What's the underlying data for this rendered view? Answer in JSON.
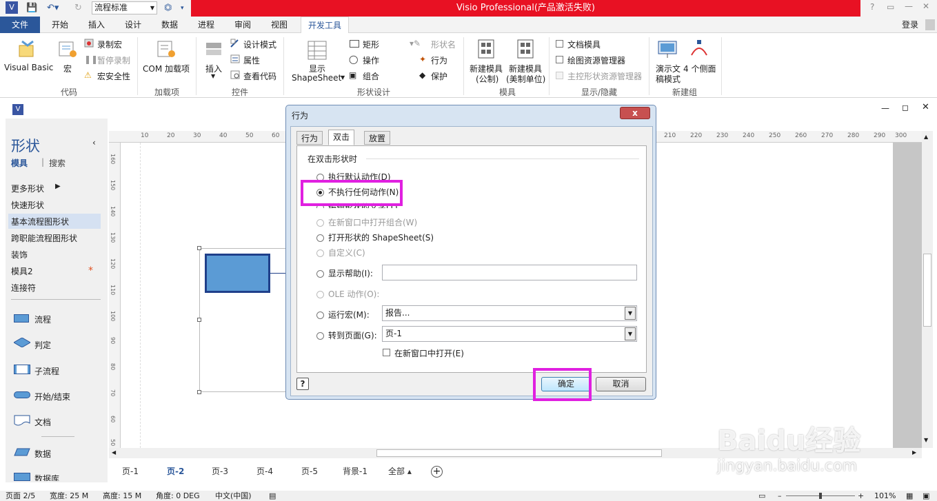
{
  "window": {
    "title": "Visio Professional(产品激活失败)",
    "style_combo": "流程标准",
    "login": "登录"
  },
  "menu": [
    "文件",
    "开始",
    "插入",
    "设计",
    "数据",
    "进程",
    "审阅",
    "视图",
    "开发工具"
  ],
  "ribbon": {
    "code": {
      "label": "代码",
      "visual_basic": "Visual Basic",
      "macros": "宏",
      "record_macro": "录制宏",
      "pause_record": "暂停录制",
      "macro_security": "宏安全性"
    },
    "addins": {
      "label": "加载项",
      "com": "COM 加载项"
    },
    "controls": {
      "label": "控件",
      "insert": "插入",
      "design_mode": "设计模式",
      "properties": "属性",
      "view_code": "查看代码"
    },
    "shape_design": {
      "label": "形状设计",
      "show_shapesheet_1": "显示",
      "show_shapesheet_2": "ShapeSheet",
      "rectangle": "矩形",
      "operations": "操作",
      "group": "组合",
      "shape_name": "形状名",
      "behavior": "行为",
      "protect": "保护"
    },
    "stencil": {
      "label": "模具",
      "new_metric_1": "新建模具",
      "new_metric_2": "(公制)",
      "new_us_1": "新建模具",
      "new_us_2": "(美制单位)"
    },
    "show_hide": {
      "label": "显示/隐藏",
      "doc_stencil": "文档模具",
      "drawing_explorer": "绘图资源管理器",
      "master_explorer": "主控形状资源管理器"
    },
    "new_group": {
      "label": "新建组",
      "demo_1": "演示文",
      "demo_2": "稿模式",
      "four_sides": "4 个侧面"
    }
  },
  "shapes_pane": {
    "title": "形状",
    "tab_stencils": "模具",
    "tab_search": "搜索",
    "nav": [
      "更多形状",
      "快速形状",
      "基本流程图形状",
      "跨职能流程图形状",
      "装饰",
      "模具2",
      "连接符"
    ],
    "shapes": [
      "流程",
      "判定",
      "子流程",
      "开始/结束",
      "文档",
      "数据",
      "数据库"
    ]
  },
  "rulers": {
    "top": [
      "10",
      "20",
      "30",
      "40",
      "50",
      "60",
      "210",
      "220",
      "230",
      "240",
      "250",
      "260",
      "270",
      "280",
      "290",
      "300"
    ],
    "left": [
      "160",
      "150",
      "140",
      "130",
      "120",
      "110",
      "100",
      "90",
      "80",
      "70",
      "60",
      "50"
    ]
  },
  "page_tabs": [
    "页-1",
    "页-2",
    "页-3",
    "页-4",
    "页-5",
    "背景-1",
    "全部 ▴"
  ],
  "status": {
    "page": "页面 2/5",
    "width": "宽度: 25 M",
    "height": "高度: 15 M",
    "angle": "角度: 0 DEG",
    "language": "中文(中国)",
    "zoom": "101%"
  },
  "dialog": {
    "title": "行为",
    "close": "x",
    "tabs": [
      "行为",
      "双击",
      "放置"
    ],
    "section": "在双击形状时",
    "opt_default": "执行默认动作(D)",
    "opt_none": "不执行任何动作(N)",
    "opt_edit_text": "编辑形状的文字(T)",
    "opt_open_group": "在新窗口中打开组合(W)",
    "opt_shapesheet": "打开形状的 ShapeSheet(S)",
    "opt_custom": "自定义(C)",
    "opt_help": "显示帮助(I):",
    "opt_ole": "OLE 动作(O):",
    "opt_macro": "运行宏(M):",
    "macro_value": "报告...",
    "opt_goto": "转到页面(G):",
    "goto_value": "页-1",
    "open_new_window": "在新窗口中打开(E)",
    "help_btn": "?",
    "ok": "确定",
    "cancel": "取消"
  },
  "watermark": {
    "logo": "Baidu经验",
    "url": "jingyan.baidu.com"
  },
  "colors": {
    "title_red": "#e81123",
    "accent": "#2b579a",
    "highlight": "#e020e0",
    "shape_fill": "#5b9bd5"
  }
}
